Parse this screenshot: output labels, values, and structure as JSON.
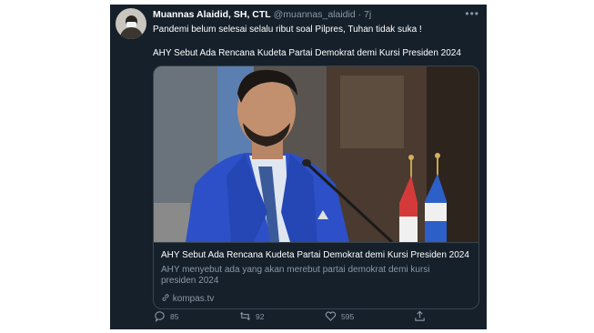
{
  "tweet": {
    "author_name": "Muannas Alaidid, SH, CTL",
    "handle": "@muannas_alaidid",
    "separator": "·",
    "time": "7j",
    "more_icon": "more-dots-icon",
    "line1": "Pandemi belum selesai selalu ribut soal Pilpres, Tuhan tidak suka !",
    "line2": "AHY Sebut Ada Rencana Kudeta Partai Demokrat demi Kursi Presiden 2024"
  },
  "card": {
    "title": "AHY Sebut Ada Rencana Kudeta Partai Demokrat demi Kursi Presiden 2024",
    "description": "AHY menyebut ada yang akan merebut partai demokrat demi kursi presiden 2024",
    "domain": "kompas.tv",
    "link_icon": "link-icon"
  },
  "actions": {
    "reply_count": "85",
    "retweet_count": "92",
    "like_count": "595",
    "reply_icon": "reply-icon",
    "retweet_icon": "retweet-icon",
    "like_icon": "heart-icon",
    "share_icon": "share-icon"
  },
  "colors": {
    "background": "#15202b",
    "secondary_text": "#8b98a5",
    "border": "#38444d"
  }
}
